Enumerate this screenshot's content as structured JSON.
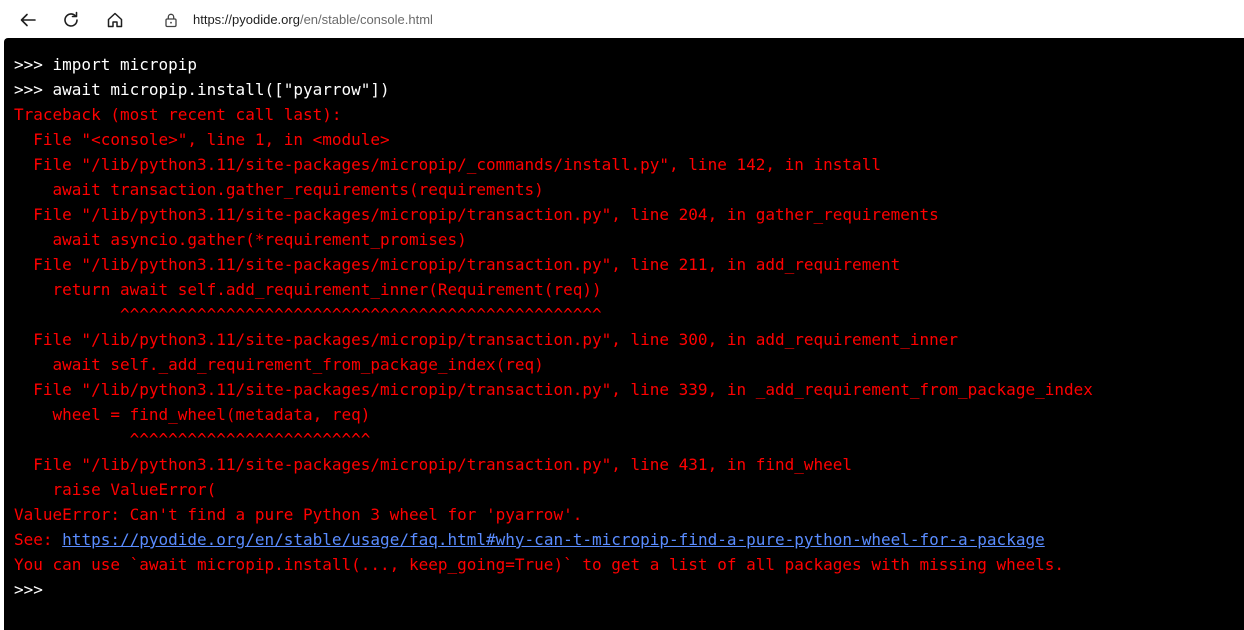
{
  "browser": {
    "url_host": "https://pyodide.org",
    "url_path": "/en/stable/console.html"
  },
  "console": {
    "lines": [
      {
        "text": ">>> import micropip",
        "kind": "input"
      },
      {
        "text": ">>> await micropip.install([\"pyarrow\"])",
        "kind": "input"
      },
      {
        "text": "Traceback (most recent call last):",
        "kind": "err"
      },
      {
        "text": "  File \"<console>\", line 1, in <module>",
        "kind": "err"
      },
      {
        "text": "  File \"/lib/python3.11/site-packages/micropip/_commands/install.py\", line 142, in install",
        "kind": "err"
      },
      {
        "text": "    await transaction.gather_requirements(requirements)",
        "kind": "err"
      },
      {
        "text": "  File \"/lib/python3.11/site-packages/micropip/transaction.py\", line 204, in gather_requirements",
        "kind": "err"
      },
      {
        "text": "    await asyncio.gather(*requirement_promises)",
        "kind": "err"
      },
      {
        "text": "  File \"/lib/python3.11/site-packages/micropip/transaction.py\", line 211, in add_requirement",
        "kind": "err"
      },
      {
        "text": "    return await self.add_requirement_inner(Requirement(req))",
        "kind": "err"
      },
      {
        "text": "           ^^^^^^^^^^^^^^^^^^^^^^^^^^^^^^^^^^^^^^^^^^^^^^^^^^",
        "kind": "err"
      },
      {
        "text": "  File \"/lib/python3.11/site-packages/micropip/transaction.py\", line 300, in add_requirement_inner",
        "kind": "err"
      },
      {
        "text": "    await self._add_requirement_from_package_index(req)",
        "kind": "err"
      },
      {
        "text": "  File \"/lib/python3.11/site-packages/micropip/transaction.py\", line 339, in _add_requirement_from_package_index",
        "kind": "err"
      },
      {
        "text": "    wheel = find_wheel(metadata, req)",
        "kind": "err"
      },
      {
        "text": "            ^^^^^^^^^^^^^^^^^^^^^^^^^",
        "kind": "err"
      },
      {
        "text": "  File \"/lib/python3.11/site-packages/micropip/transaction.py\", line 431, in find_wheel",
        "kind": "err"
      },
      {
        "text": "    raise ValueError(",
        "kind": "err"
      },
      {
        "text": "ValueError: Can't find a pure Python 3 wheel for 'pyarrow'.",
        "kind": "err"
      }
    ],
    "see_prefix": "See: ",
    "see_link": "https://pyodide.org/en/stable/usage/faq.html#why-can-t-micropip-find-a-pure-python-wheel-for-a-package",
    "hint": "You can use `await micropip.install(..., keep_going=True)` to get a list of all packages with missing wheels.",
    "prompt": ">>>"
  }
}
